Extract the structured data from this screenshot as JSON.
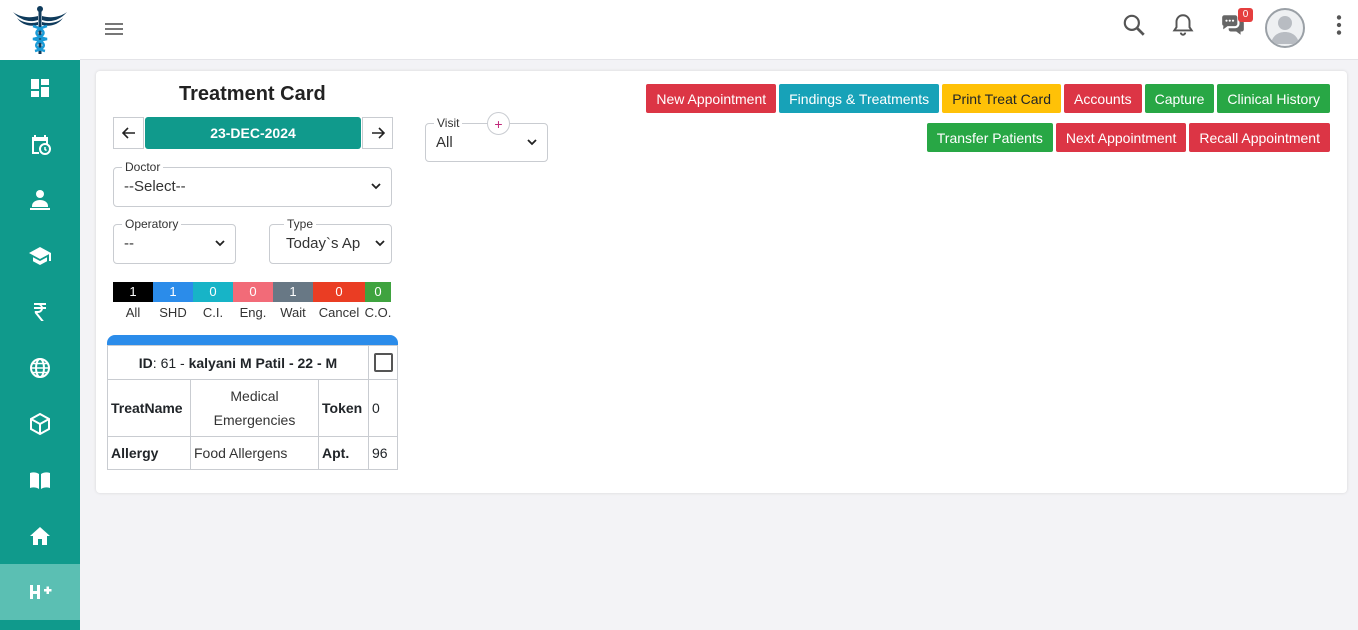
{
  "sidebar": {
    "items": [
      {
        "icon": "dashboard-icon"
      },
      {
        "icon": "calendar-clock-icon"
      },
      {
        "icon": "patient-icon"
      },
      {
        "icon": "graduation-cap-icon"
      },
      {
        "icon": "rupee-icon"
      },
      {
        "icon": "globe-icon"
      },
      {
        "icon": "cube-icon"
      },
      {
        "icon": "book-icon"
      },
      {
        "icon": "home-icon"
      },
      {
        "icon": "hospital-plus-icon"
      }
    ]
  },
  "topbar": {
    "chat_badge": "0"
  },
  "page": {
    "title": "Treatment Card",
    "date": "23-DEC-2024"
  },
  "filters": {
    "doctor_legend": "Doctor",
    "doctor_value": "--Select--",
    "operatory_legend": "Operatory",
    "operatory_value": "--",
    "type_legend": "Type",
    "type_value": "Today`s Ap",
    "visit_legend": "Visit",
    "visit_value": "All",
    "visit_add": "+"
  },
  "stats": [
    {
      "count": "1",
      "label": "All",
      "color": "#000000"
    },
    {
      "count": "1",
      "label": "SHD",
      "color": "#2b8cea"
    },
    {
      "count": "0",
      "label": "C.I.",
      "color": "#17b4c7"
    },
    {
      "count": "0",
      "label": "Eng.",
      "color": "#f26b78"
    },
    {
      "count": "1",
      "label": "Wait",
      "color": "#687885"
    },
    {
      "count": "0",
      "label": "Cancel",
      "color": "#ea3d23"
    },
    {
      "count": "0",
      "label": "C.O.",
      "color": "#3fa33f"
    }
  ],
  "patient": {
    "id_label": "ID",
    "id_value": ": 61 - ",
    "name": "kalyani M Patil - 22 - M",
    "treat_label": "TreatName",
    "treat_value": "Medical Emergencies",
    "token_label": "Token",
    "token_value": "0",
    "allergy_label": "Allergy",
    "allergy_value": "Food Allergens",
    "apt_label": "Apt.",
    "apt_value": "96"
  },
  "buttons": {
    "row1": [
      {
        "label": "New Appointment",
        "color": "#dc3545"
      },
      {
        "label": "Findings & Treatments",
        "color": "#17a2b8"
      },
      {
        "label": "Print Treat Card",
        "color": "#ffc107"
      },
      {
        "label": "Accounts",
        "color": "#dc3545"
      },
      {
        "label": "Capture",
        "color": "#28a745"
      },
      {
        "label": "Clinical History",
        "color": "#28a745"
      }
    ],
    "row2": [
      {
        "label": "Transfer Patients",
        "color": "#28a745"
      },
      {
        "label": "Next Appointment",
        "color": "#dc3545"
      },
      {
        "label": "Recall Appointment",
        "color": "#dc3545"
      }
    ]
  }
}
